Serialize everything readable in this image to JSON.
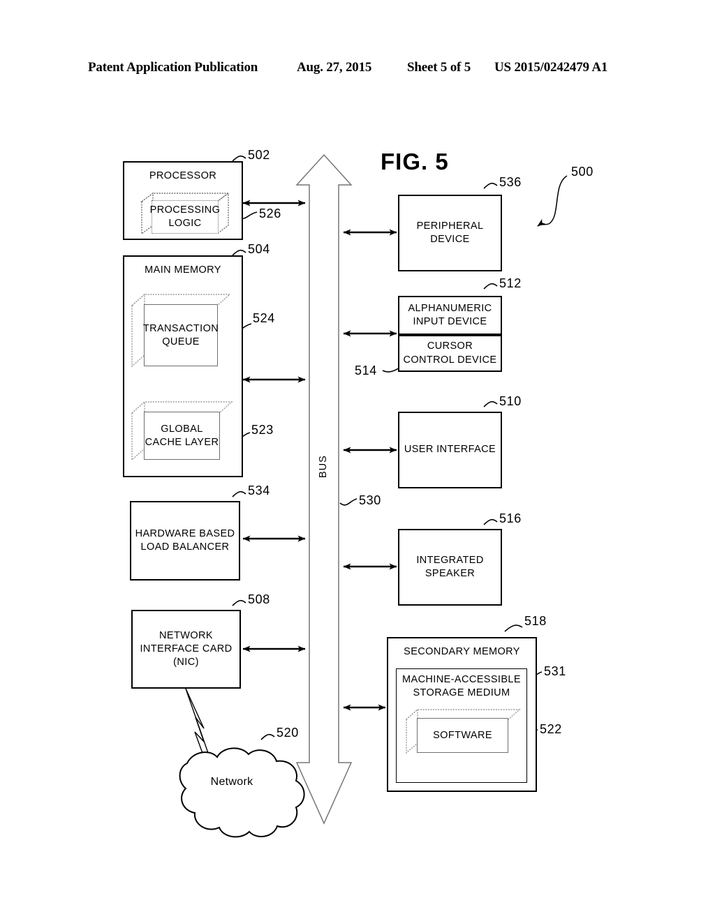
{
  "header": {
    "publication": "Patent Application Publication",
    "date": "Aug. 27, 2015",
    "sheet": "Sheet 5 of 5",
    "patent_number": "US 2015/0242479 A1"
  },
  "figure": {
    "title": "FIG. 5",
    "system_ref": "500",
    "bus_label": "BUS",
    "bus_ref": "530"
  },
  "blocks": {
    "processor": {
      "label": "PROCESSOR",
      "ref": "502"
    },
    "processing_logic": {
      "label": "PROCESSING\nLOGIC",
      "ref": "526"
    },
    "main_memory": {
      "label": "MAIN MEMORY",
      "ref": "504"
    },
    "transaction_queue": {
      "label": "TRANSACTION\nQUEUE",
      "ref": "524"
    },
    "global_cache_layer": {
      "label": "GLOBAL\nCACHE LAYER",
      "ref": "523"
    },
    "load_balancer": {
      "label": "HARDWARE BASED\nLOAD BALANCER",
      "ref": "534"
    },
    "nic": {
      "label": "NETWORK\nINTERFACE CARD\n(NIC)",
      "ref": "508"
    },
    "network": {
      "label": "Network",
      "ref": "520"
    },
    "peripheral_device": {
      "label": "PERIPHERAL\nDEVICE",
      "ref": "536"
    },
    "alphanumeric_input": {
      "label": "ALPHANUMERIC\nINPUT DEVICE",
      "ref": "512"
    },
    "cursor_control": {
      "label": "CURSOR\nCONTROL DEVICE",
      "ref": "514"
    },
    "user_interface": {
      "label": "USER INTERFACE",
      "ref": "510"
    },
    "integrated_speaker": {
      "label": "INTEGRATED\nSPEAKER",
      "ref": "516"
    },
    "secondary_memory": {
      "label": "SECONDARY MEMORY",
      "ref": "518"
    },
    "storage_medium": {
      "label": "MACHINE-ACCESSIBLE\nSTORAGE MEDIUM",
      "ref": "531"
    },
    "software": {
      "label": "SOFTWARE",
      "ref": "522"
    }
  },
  "colors": {
    "ink": "#000000",
    "paper": "#ffffff",
    "box3d_edge": "#6f6f6f",
    "bus_outline": "#777777"
  }
}
